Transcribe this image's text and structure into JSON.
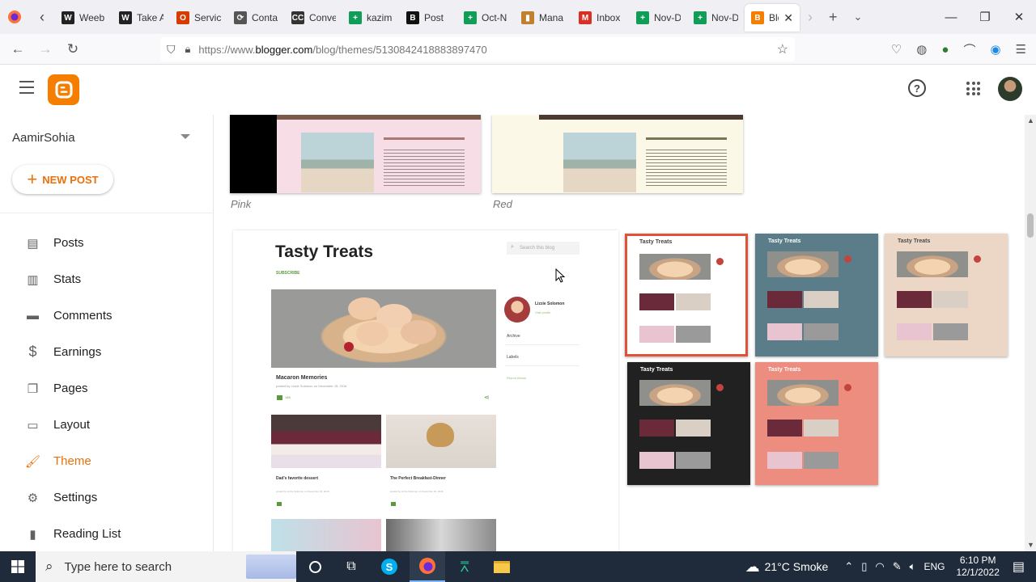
{
  "browser": {
    "tabs": [
      {
        "label": "Weeb",
        "color": "#222",
        "glyph": "W"
      },
      {
        "label": "Take A",
        "color": "#222",
        "glyph": "W"
      },
      {
        "label": "Servic",
        "color": "#d83b01",
        "glyph": "O"
      },
      {
        "label": "Conta",
        "color": "#555",
        "glyph": "⟳"
      },
      {
        "label": "Conve",
        "color": "#333",
        "glyph": "CC"
      },
      {
        "label": "kazim",
        "color": "#0f9d58",
        "glyph": "+"
      },
      {
        "label": "Post",
        "color": "#111",
        "glyph": "B"
      },
      {
        "label": "Oct-N",
        "color": "#0f9d58",
        "glyph": "+"
      },
      {
        "label": "Mana",
        "color": "#c0812e",
        "glyph": "▮"
      },
      {
        "label": "Inbox",
        "color": "#d93025",
        "glyph": "M"
      },
      {
        "label": "Nov-D",
        "color": "#0f9d58",
        "glyph": "+"
      },
      {
        "label": "Nov-D",
        "color": "#0f9d58",
        "glyph": "+"
      }
    ],
    "active_tab": {
      "label": "Blo",
      "glyph": "B",
      "color": "#f57d00"
    },
    "url": {
      "scheme": "https://www.",
      "host": "blogger.com",
      "path": "/blog/themes/5130842418883897470"
    }
  },
  "sidebar": {
    "account": "AamirSohia",
    "new_post": "NEW POST",
    "items": [
      {
        "label": "Posts",
        "icon": "posts-icon"
      },
      {
        "label": "Stats",
        "icon": "stats-icon"
      },
      {
        "label": "Comments",
        "icon": "comments-icon"
      },
      {
        "label": "Earnings",
        "icon": "earnings-icon"
      },
      {
        "label": "Pages",
        "icon": "pages-icon"
      },
      {
        "label": "Layout",
        "icon": "layout-icon"
      },
      {
        "label": "Theme",
        "icon": "theme-icon"
      },
      {
        "label": "Settings",
        "icon": "settings-icon"
      },
      {
        "label": "Reading List",
        "icon": "reading-list-icon"
      }
    ],
    "active": "Theme"
  },
  "themes": {
    "top_captions": [
      "Pink",
      "Red"
    ],
    "preview": {
      "blog_title": "Tasty Treats",
      "subscribe": "SUBSCRIBE",
      "search_placeholder": "Search this blog",
      "profile_name": "Lizzie Solomon",
      "profile_link": "Visit profile",
      "archive": "Archive",
      "labels": "Labels",
      "report_abuse": "Report Abuse",
      "post1_title": "Macaron Memories",
      "post1_meta": "posted by Lizzie Solomon on December 15, 2016",
      "post2_title": "Dad's favorite dessert",
      "post3_title": "The Perfect Breakfast-Dinner",
      "post_meta": "posted by Lizzie Solomon on December 15, 2016",
      "comment_count": "145"
    },
    "variants": [
      {
        "title": "Tasty Treats",
        "bg": "#ffffff",
        "header": "#ffffff",
        "text": "#444444",
        "selected": true
      },
      {
        "title": "Tasty Treats",
        "bg": "#5b7d8a",
        "header": "#5b7d8a",
        "text": "#ffffff",
        "selected": false
      },
      {
        "title": "Tasty Treats",
        "bg": "#ecd7c7",
        "header": "#ecd7c7",
        "text": "#4a4a4a",
        "selected": false
      },
      {
        "title": "Tasty Treats",
        "bg": "#212121",
        "header": "#212121",
        "text": "#ffffff",
        "selected": false
      },
      {
        "title": "Tasty Treats",
        "bg": "#ec8d80",
        "header": "#ec8d80",
        "text": "#ffffff",
        "selected": false
      }
    ],
    "selected_border": "#e0513a"
  },
  "taskbar": {
    "search_placeholder": "Type here to search",
    "weather": "21°C  Smoke",
    "lang": "ENG",
    "time": "6:10 PM",
    "date": "12/1/2022"
  }
}
